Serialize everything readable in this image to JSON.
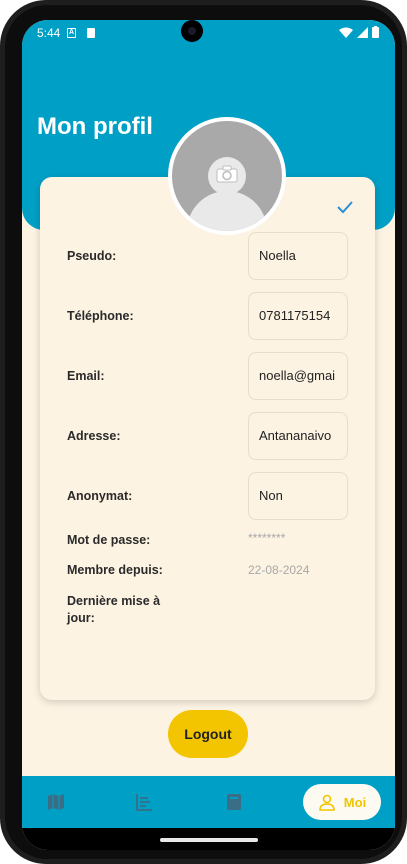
{
  "status_bar": {
    "time": "5:44",
    "app_icon_letter": "A"
  },
  "header": {
    "title": "Mon profil"
  },
  "profile": {
    "fields": [
      {
        "label": "Pseudo:",
        "value": "Noella"
      },
      {
        "label": "Téléphone:",
        "value": "0781175154"
      },
      {
        "label": "Email:",
        "value": "noella@gmai"
      },
      {
        "label": "Adresse:",
        "value": "Antananaivo"
      },
      {
        "label": "Anonymat:",
        "value": "Non"
      }
    ],
    "password": {
      "label": "Mot de passe:",
      "value": "********"
    },
    "member_since": {
      "label": "Membre depuis:",
      "value": "22-08-2024"
    },
    "last_update": {
      "label": "Dernière mise à jour:",
      "value": ""
    }
  },
  "actions": {
    "logout_label": "Logout"
  },
  "bottom_nav": {
    "items": [
      {
        "icon": "map-icon"
      },
      {
        "icon": "list-chart-icon"
      },
      {
        "icon": "book-icon"
      },
      {
        "icon": "person-icon",
        "label": "Moi",
        "active": true
      }
    ]
  },
  "colors": {
    "header": "#00a0c6",
    "background": "#fcf3e3",
    "accent": "#f2c500",
    "check": "#2c8fd6"
  }
}
